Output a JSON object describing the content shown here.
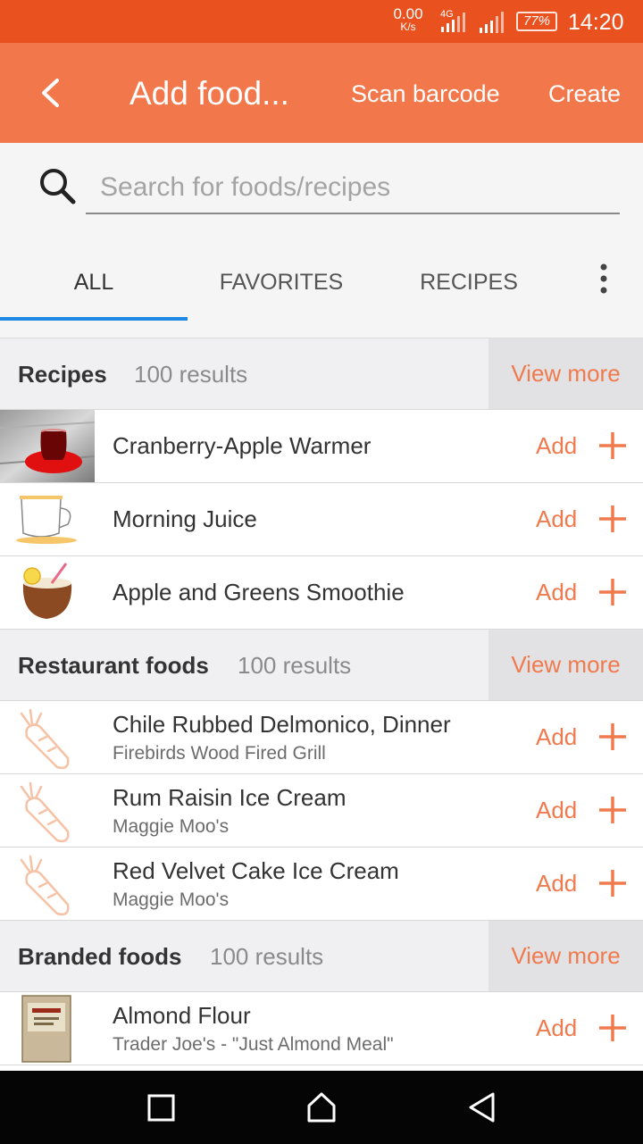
{
  "status_bar": {
    "net_rate": "0.00",
    "net_unit": "K/s",
    "network_type": "4G",
    "battery": "77%",
    "time": "14:20"
  },
  "app_bar": {
    "title": "Add food...",
    "scan_label": "Scan barcode",
    "create_label": "Create",
    "back_icon": "chevron-left-icon"
  },
  "search": {
    "placeholder": "Search for foods/recipes",
    "value": ""
  },
  "tabs": [
    {
      "label": "ALL",
      "active": true
    },
    {
      "label": "FAVORITES",
      "active": false
    },
    {
      "label": "RECIPES",
      "active": false
    }
  ],
  "sections": [
    {
      "title": "Recipes",
      "count": "100 results",
      "view_more": "View more",
      "items": [
        {
          "name": "Cranberry-Apple Warmer",
          "sub": "",
          "add": "Add",
          "thumb": "tea-glass-photo"
        },
        {
          "name": "Morning Juice",
          "sub": "",
          "add": "Add",
          "thumb": "teacup-icon"
        },
        {
          "name": "Apple and Greens Smoothie",
          "sub": "",
          "add": "Add",
          "thumb": "coconut-drink-icon"
        }
      ]
    },
    {
      "title": "Restaurant foods",
      "count": "100 results",
      "view_more": "View more",
      "items": [
        {
          "name": "Chile Rubbed Delmonico, Dinner",
          "sub": "Firebirds Wood Fired Grill",
          "add": "Add",
          "thumb": "carrot-icon"
        },
        {
          "name": "Rum Raisin Ice Cream",
          "sub": "Maggie Moo's",
          "add": "Add",
          "thumb": "carrot-icon"
        },
        {
          "name": "Red Velvet Cake Ice Cream",
          "sub": "Maggie Moo's",
          "add": "Add",
          "thumb": "carrot-icon"
        }
      ]
    },
    {
      "title": "Branded foods",
      "count": "100 results",
      "view_more": "View more",
      "items": [
        {
          "name": "Almond Flour",
          "sub": "Trader Joe's - \"Just Almond Meal\"",
          "add": "Add",
          "thumb": "flour-bag-photo"
        }
      ]
    }
  ],
  "colors": {
    "status_bar": "#e9511f",
    "app_bar": "#f2774b",
    "accent": "#f07a4d",
    "tab_indicator": "#1e88e5"
  }
}
